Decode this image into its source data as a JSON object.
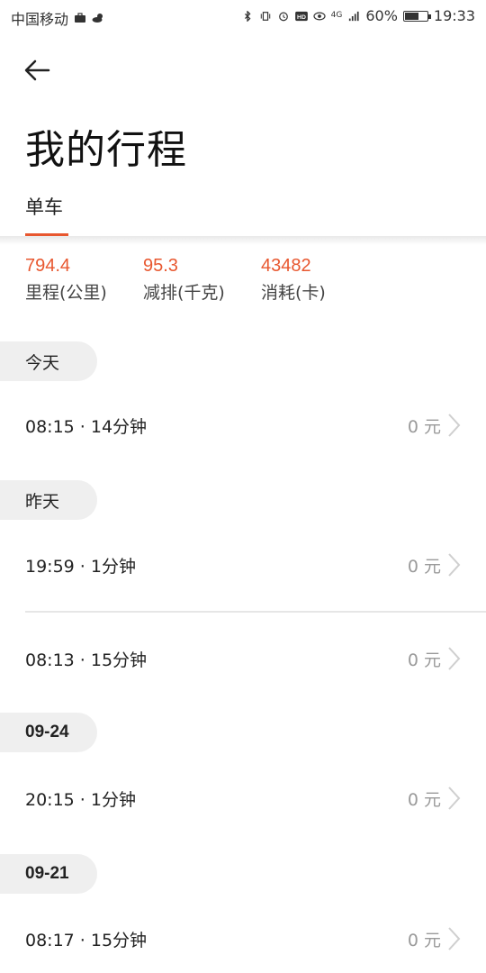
{
  "status_bar": {
    "carrier": "中国移动",
    "network": "4G",
    "battery": "60%",
    "battery_level": 0.6,
    "time": "19:33",
    "icons": [
      "briefcase-icon",
      "weather-icon",
      "bluetooth-icon",
      "vibrate-icon",
      "alarm-icon",
      "hd-icon",
      "eye-icon",
      "signal-icon",
      "battery-icon"
    ]
  },
  "header": {
    "back_icon": "back-arrow-icon",
    "title": "我的行程",
    "tabs": [
      {
        "label": "单车",
        "active": true
      }
    ]
  },
  "stats": [
    {
      "value": "794.4",
      "label": "里程(公里)"
    },
    {
      "value": "95.3",
      "label": "减排(千克)"
    },
    {
      "value": "43482",
      "label": "消耗(卡)"
    }
  ],
  "groups": [
    {
      "date": "今天",
      "trips": [
        {
          "time": "08:15 · 14分钟",
          "price": "0 元"
        }
      ]
    },
    {
      "date": "昨天",
      "trips": [
        {
          "time": "19:59 · 1分钟",
          "price": "0 元"
        },
        {
          "time": "08:13 · 15分钟",
          "price": "0 元"
        }
      ]
    },
    {
      "date": "09-24",
      "trips": [
        {
          "time": "20:15 · 1分钟",
          "price": "0 元"
        }
      ]
    },
    {
      "date": "09-21",
      "trips": [
        {
          "time": "08:17 · 15分钟",
          "price": "0 元"
        }
      ]
    }
  ],
  "colors": {
    "accent": "#e8572f",
    "pill_bg": "#efefef",
    "muted": "#9a9a9a"
  }
}
